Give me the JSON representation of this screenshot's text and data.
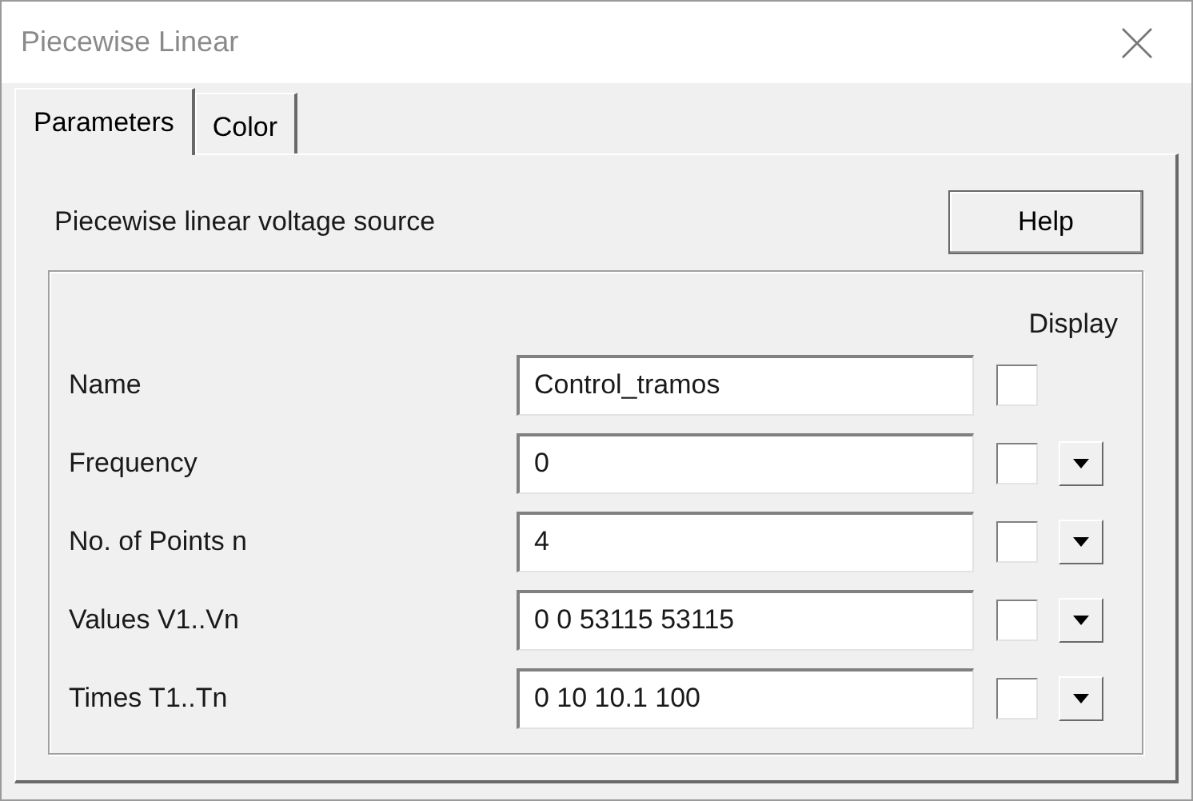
{
  "window": {
    "title": "Piecewise Linear"
  },
  "tabs": [
    {
      "label": "Parameters",
      "selected": true
    },
    {
      "label": "Color",
      "selected": false
    }
  ],
  "description": "Piecewise linear voltage source",
  "help_button": "Help",
  "display_header": "Display",
  "parameters": [
    {
      "kind": "plain",
      "label": "Name",
      "value": "Control_tramos",
      "display": false
    },
    {
      "kind": "dropdown",
      "label": "Frequency",
      "value": "0",
      "display": false
    },
    {
      "kind": "dropdown",
      "label": "No. of Points n",
      "value": "4",
      "display": false
    },
    {
      "kind": "dropdown",
      "label": "Values V1..Vn",
      "value": "0 0 53115 53115",
      "display": false
    },
    {
      "kind": "dropdown",
      "label": "Times T1..Tn",
      "value": "0 10 10.1 100",
      "display": false
    }
  ]
}
